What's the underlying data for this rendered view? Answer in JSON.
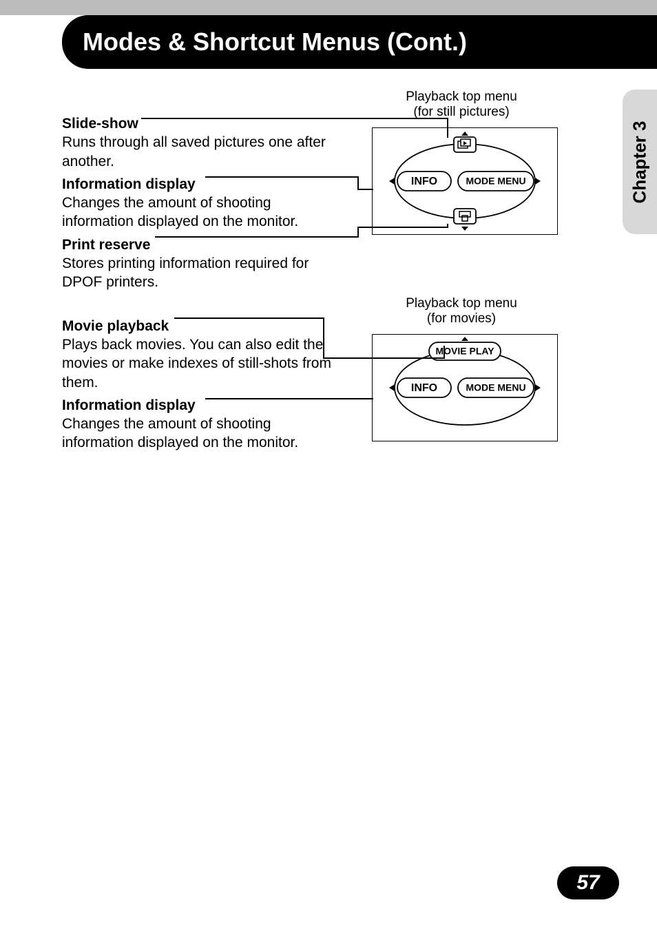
{
  "header": {
    "title": "Modes & Shortcut Menus (Cont.)"
  },
  "chapter_tab": "Chapter 3",
  "page_number": "57",
  "still": {
    "label_line1": "Playback top menu",
    "label_line2": "(for still pictures)",
    "top_icon": "slideshow-icon",
    "left_pill": "INFO",
    "right_pill": "MODE MENU",
    "bottom_icon": "print-icon"
  },
  "movie": {
    "label_line1": "Playback top menu",
    "label_line2": "(for movies)",
    "top_pill": "MOVIE PLAY",
    "left_pill": "INFO",
    "right_pill": "MODE MENU"
  },
  "items": {
    "slide_show": {
      "head": "Slide-show",
      "desc": "Runs through all saved pictures one after another."
    },
    "info1": {
      "head": "Information display",
      "desc": "Changes the amount of shooting information displayed on the monitor."
    },
    "print": {
      "head": "Print reserve",
      "desc": "Stores printing information required for DPOF printers."
    },
    "movie": {
      "head": "Movie playback",
      "desc": "Plays back movies. You can also edit the movies or make indexes of still-shots from them."
    },
    "info2": {
      "head": "Information display",
      "desc": "Changes the amount of shooting information displayed on the monitor."
    }
  }
}
